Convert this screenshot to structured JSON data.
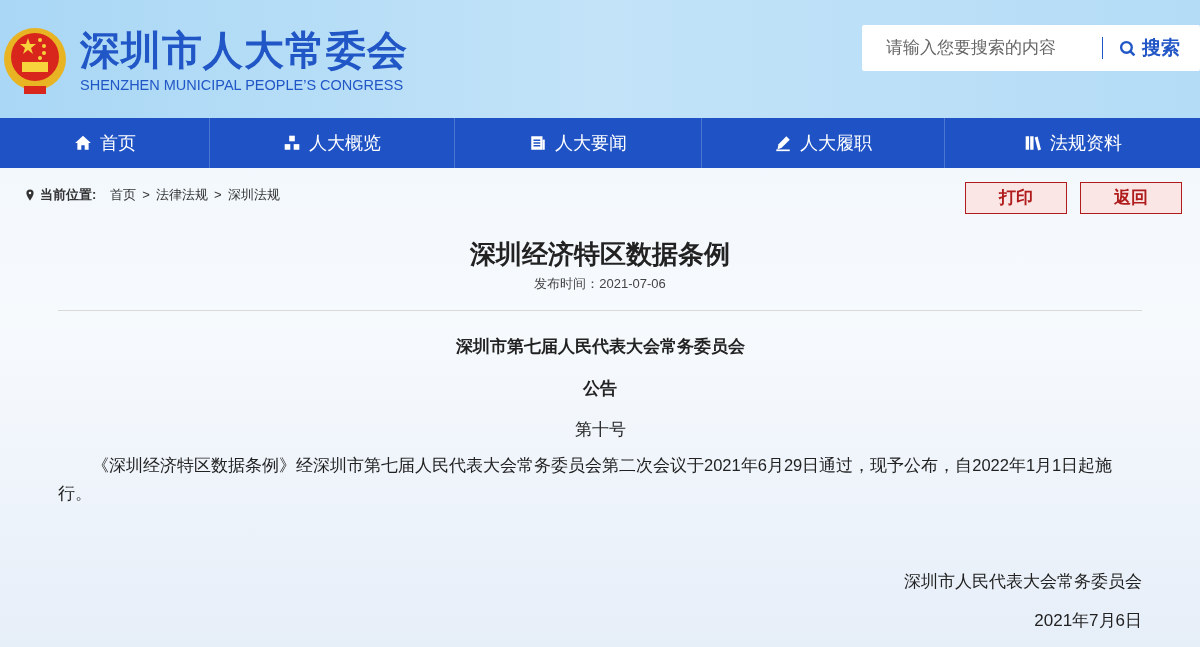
{
  "header": {
    "title": "深圳市人大常委会",
    "subtitle": "SHENZHEN MUNICIPAL PEOPLE’S CONGRESS",
    "search": {
      "placeholder": "请输入您要搜索的内容",
      "button": "搜索"
    }
  },
  "nav": [
    {
      "label": "首页",
      "kind": "home"
    },
    {
      "label": "人大概览",
      "kind": "overview"
    },
    {
      "label": "人大要闻",
      "kind": "news"
    },
    {
      "label": "人大履职",
      "kind": "duty"
    },
    {
      "label": "法规资料",
      "kind": "library"
    }
  ],
  "breadcrumb": {
    "label": "当前位置:",
    "separator": ">",
    "items": [
      "首页",
      "法律法规",
      "深圳法规"
    ]
  },
  "actions": [
    "打印",
    "返回"
  ],
  "article": {
    "title": "深圳经济特区数据条例",
    "date": "发布时间：2021-07-06",
    "issuer": "深圳市第七届人民代表大会常务委员会",
    "doc_type": "公告",
    "number": "第十号",
    "body": "《深圳经济特区数据条例》经深圳市第七届人民代表大会常务委员会第二次会议于2021年6月29日通过，现予公布，自2022年1月1日起施行。",
    "signature": "深圳市人民代表大会常务委员会",
    "sign_date": "2021年7月6日"
  }
}
